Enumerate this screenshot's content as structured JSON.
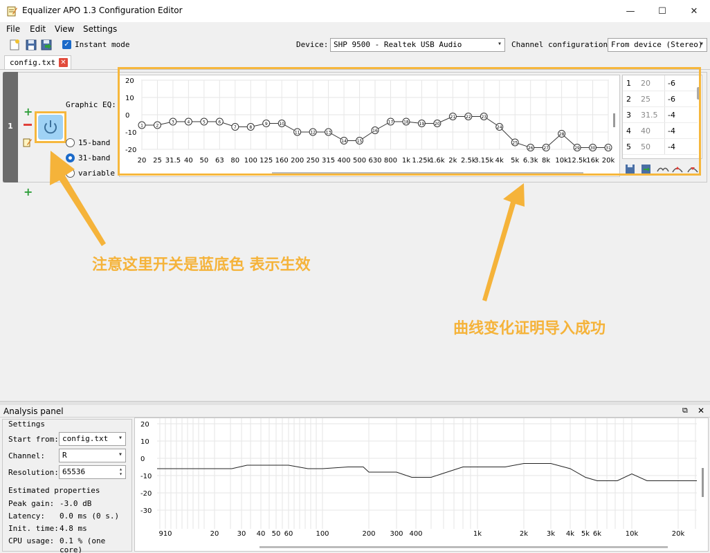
{
  "window": {
    "title": "Equalizer APO 1.3 Configuration Editor",
    "minimize": "—",
    "maximize": "☐",
    "close": "✕"
  },
  "menu": [
    "File",
    "Edit",
    "View",
    "Settings"
  ],
  "toolbar": {
    "instant_mode_label": "Instant mode",
    "instant_mode_checked": true,
    "device_label": "Device:",
    "device_value": "SHP 9500 - Realtek USB Audio",
    "channel_config_label": "Channel configuration:",
    "channel_config_value": "From device (Stereo)"
  },
  "tab": {
    "label": "config.txt"
  },
  "filter": {
    "number": "1",
    "graphic_eq_label": "Graphic EQ:",
    "band_options": [
      "15-band",
      "31-band",
      "variable"
    ],
    "selected_band": "31-band",
    "y_ticks": [
      "20",
      "10",
      "0",
      "-10",
      "-20"
    ],
    "x_labels": [
      "20",
      "25",
      "31.5",
      "40",
      "50",
      "63",
      "80",
      "100",
      "125",
      "160",
      "200",
      "250",
      "315",
      "400",
      "500",
      "630",
      "800",
      "1k",
      "1.25k",
      "1.6k",
      "2k",
      "2.5k",
      "3.15k",
      "4k",
      "5k",
      "6.3k",
      "8k",
      "10k",
      "12.5k",
      "16k",
      "20k"
    ],
    "gains": [
      -6,
      -6,
      -4,
      -4,
      -4,
      -4,
      -7,
      -7,
      -5,
      -5,
      -10,
      -10,
      -10,
      -15,
      -15,
      -9,
      -4,
      -4,
      -5,
      -5,
      -1,
      -1,
      -1,
      -7,
      -16,
      -19,
      -19,
      -11,
      -19,
      -19,
      -19
    ],
    "table": [
      {
        "idx": "1",
        "freq": "20",
        "gain": "-6"
      },
      {
        "idx": "2",
        "freq": "25",
        "gain": "-6"
      },
      {
        "idx": "3",
        "freq": "31.5",
        "gain": "-4"
      },
      {
        "idx": "4",
        "freq": "40",
        "gain": "-4"
      },
      {
        "idx": "5",
        "freq": "50",
        "gain": "-4"
      }
    ]
  },
  "annotations": {
    "power_note": "注意这里开关是蓝底色 表示生效",
    "curve_note": "曲线变化证明导入成功"
  },
  "analysis": {
    "title": "Analysis panel",
    "settings_title": "Settings",
    "start_from_label": "Start from:",
    "start_from_value": "config.txt",
    "channel_label": "Channel:",
    "channel_value": "R",
    "resolution_label": "Resolution:",
    "resolution_value": "65536",
    "estimated_title": "Estimated properties",
    "peak_gain_label": "Peak gain:",
    "peak_gain_value": "-3.0 dB",
    "latency_label": "Latency:",
    "latency_value": "0.0 ms (0 s.)",
    "init_time_label": "Init. time:",
    "init_time_value": "4.8 ms",
    "cpu_label": "CPU usage:",
    "cpu_value": "0.1 % (one core)",
    "y_ticks": [
      "20",
      "10",
      "0",
      "-10",
      "-20",
      "-30"
    ],
    "x_labels": [
      "910",
      "20",
      "30",
      "40",
      "50",
      "60",
      "100",
      "200",
      "300",
      "400",
      "1k",
      "2k",
      "3k",
      "4k",
      "5k",
      "6k",
      "10k",
      "20k"
    ]
  }
}
